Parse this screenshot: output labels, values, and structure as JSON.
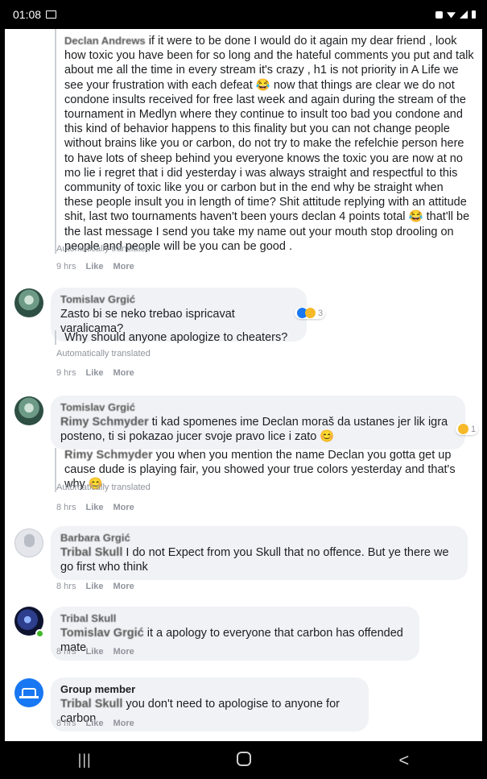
{
  "status_bar": {
    "time": "01:08"
  },
  "comments": [
    {
      "id": "declan",
      "name": "Declan Andrews",
      "translation_text": "if it were to be done I would do it again my dear friend , look how toxic you have been for so long and the hateful comments you put and talk about me all the time in every stream it's crazy , h1 is not priority in A Life we see your frustration with each defeat 😂 now that things are clear we do not condone insults received for free last week and again during the stream of the tournament in Medlyn where they continue to insult too bad you condone and this kind of behavior happens to this finality but you can not change people without brains like you or carbon, do not try to make the refelchie person here to have lots of sheep behind you everyone knows the toxic you are now at no mo lie i regret that i did yesterday i was always straight and respectful to this community of toxic like you or carbon but in the end why be straight when these people insult you in length of time? Shit attitude replying with an attitude shit, last two tournaments haven't been yours declan 4 points total 😂 that'll be the last message I send you take my name out your mouth stop drooling on people and people will be you can be good .",
      "auto_label": "Automatically translated",
      "time": "9 hrs",
      "like": "Like",
      "more": "More"
    },
    {
      "id": "tomislav1",
      "name": "Tomislav Grgić",
      "text": "Zasto bi se neko trebao ispricavat varalicama?",
      "reaction_count": "3",
      "translation_text": "Why should anyone apologize to cheaters?",
      "auto_label": "Automatically translated",
      "time": "9 hrs",
      "like": "Like",
      "more": "More"
    },
    {
      "id": "tomislav2",
      "name": "Tomislav Grgić",
      "tag": "Rimy Schmyder",
      "text": "ti kad spomenes ime Declan moraš da ustanes jer lik igra posteno, ti si pokazao jucer svoje pravo lice i zato 😊",
      "reaction_count": "1",
      "translation_tag": "Rimy Schmyder",
      "translation_text": "you when you mention the name Declan you gotta get up cause dude is playing fair, you showed your true colors yesterday and that's why 😊",
      "auto_label": "Automatically translated",
      "time": "8 hrs",
      "like": "Like",
      "more": "More"
    },
    {
      "id": "barbara",
      "name": "Barbara Grgić",
      "tag": "Tribal Skull",
      "text": "I do not Expect from you Skull that no offence. But ye there we go first who think",
      "time": "8 hrs",
      "like": "Like",
      "more": "More"
    },
    {
      "id": "skull",
      "name": "Tribal Skull",
      "tag": "Tomislav Grgić",
      "text": "it a apology to everyone that carbon has offended mate",
      "time": "8 hrs",
      "like": "Like",
      "more": "More"
    },
    {
      "id": "group",
      "name": "Group member",
      "tag": "Tribal Skull",
      "text": "you don't need to apologise to anyone for carbon",
      "time": "8 hrs",
      "like": "Like",
      "more": "More"
    }
  ],
  "nav": {
    "recents": "|||",
    "home": "○",
    "back": "<"
  }
}
